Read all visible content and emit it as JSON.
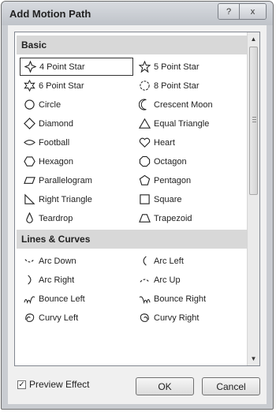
{
  "window": {
    "title": "Add Motion Path",
    "help_icon": "?",
    "close_icon": "x"
  },
  "categories": {
    "basic": "Basic",
    "lines": "Lines & Curves"
  },
  "basic_items": [
    {
      "label": "4 Point Star",
      "icon": "star4-icon"
    },
    {
      "label": "5 Point Star",
      "icon": "star5-icon"
    },
    {
      "label": "6 Point Star",
      "icon": "star6-icon"
    },
    {
      "label": "8 Point Star",
      "icon": "star8-icon"
    },
    {
      "label": "Circle",
      "icon": "circle-icon"
    },
    {
      "label": "Crescent Moon",
      "icon": "crescent-moon-icon"
    },
    {
      "label": "Diamond",
      "icon": "diamond-icon"
    },
    {
      "label": "Equal Triangle",
      "icon": "triangle-icon"
    },
    {
      "label": "Football",
      "icon": "football-icon"
    },
    {
      "label": "Heart",
      "icon": "heart-icon"
    },
    {
      "label": "Hexagon",
      "icon": "hexagon-icon"
    },
    {
      "label": "Octagon",
      "icon": "octagon-icon"
    },
    {
      "label": "Parallelogram",
      "icon": "parallelogram-icon"
    },
    {
      "label": "Pentagon",
      "icon": "pentagon-icon"
    },
    {
      "label": "Right Triangle",
      "icon": "right-triangle-icon"
    },
    {
      "label": "Square",
      "icon": "square-icon"
    },
    {
      "label": "Teardrop",
      "icon": "teardrop-icon"
    },
    {
      "label": "Trapezoid",
      "icon": "trapezoid-icon"
    }
  ],
  "lines_items": [
    {
      "label": "Arc Down",
      "icon": "arc-down-icon"
    },
    {
      "label": "Arc Left",
      "icon": "arc-left-icon"
    },
    {
      "label": "Arc Right",
      "icon": "arc-right-icon"
    },
    {
      "label": "Arc Up",
      "icon": "arc-up-icon"
    },
    {
      "label": "Bounce Left",
      "icon": "bounce-left-icon"
    },
    {
      "label": "Bounce Right",
      "icon": "bounce-right-icon"
    },
    {
      "label": "Curvy Left",
      "icon": "curvy-left-icon"
    },
    {
      "label": "Curvy Right",
      "icon": "curvy-right-icon"
    }
  ],
  "footer": {
    "preview_label": "Preview Effect",
    "preview_checked": true,
    "ok_label": "OK",
    "cancel_label": "Cancel"
  }
}
